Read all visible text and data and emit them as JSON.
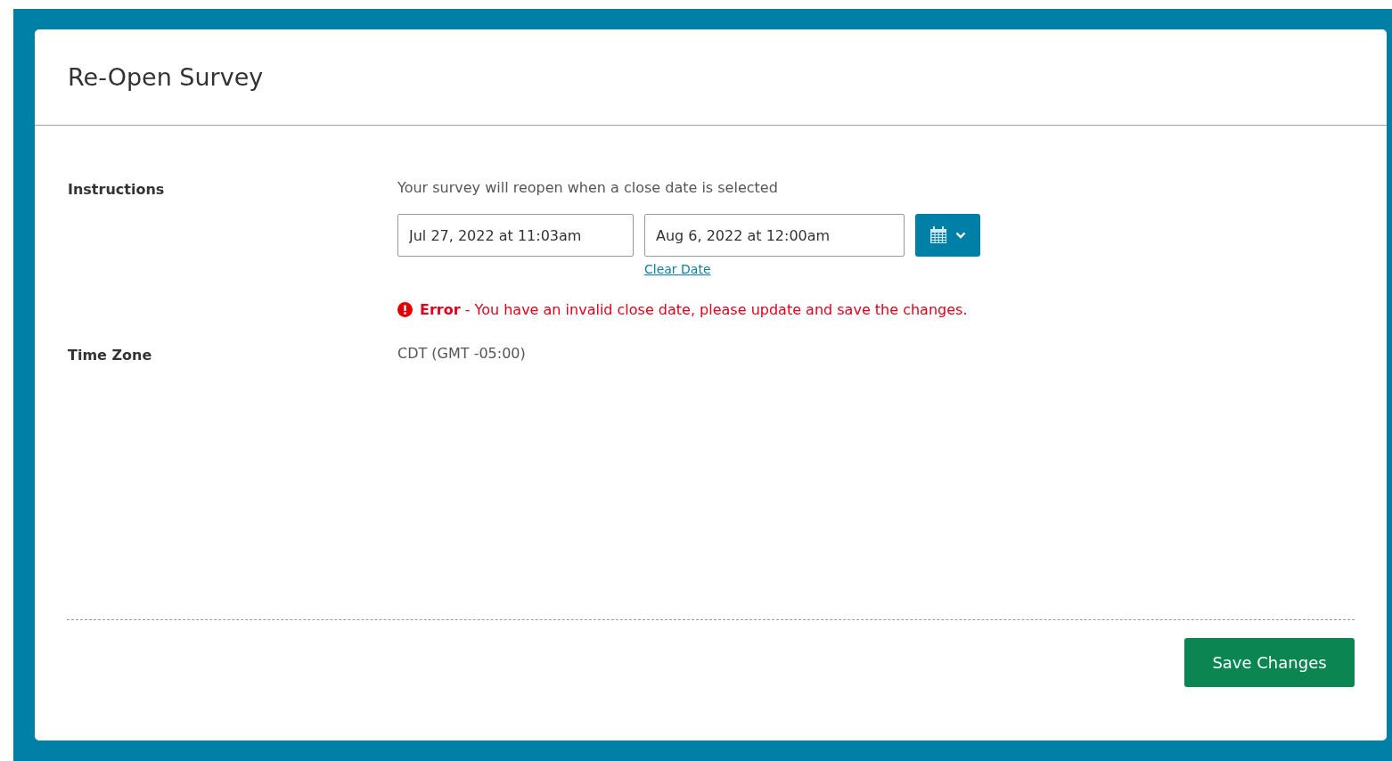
{
  "dialog": {
    "title": "Re-Open Survey"
  },
  "fields": [
    {
      "label": "Instructions",
      "hint": "Your survey will reopen when a close date is selected",
      "start_date": "Jul 27, 2022 at 11:03am",
      "close_date": "Aug 6, 2022 at 12:00am",
      "clear_link": "Clear Date",
      "error": "**Error** - You have an invalid close date, please update and save the changes."
    },
    {
      "label": "Time Zone",
      "value": "CDT (GMT -05:00)"
    }
  ],
  "buttons": [
    "Save Changes"
  ]
}
